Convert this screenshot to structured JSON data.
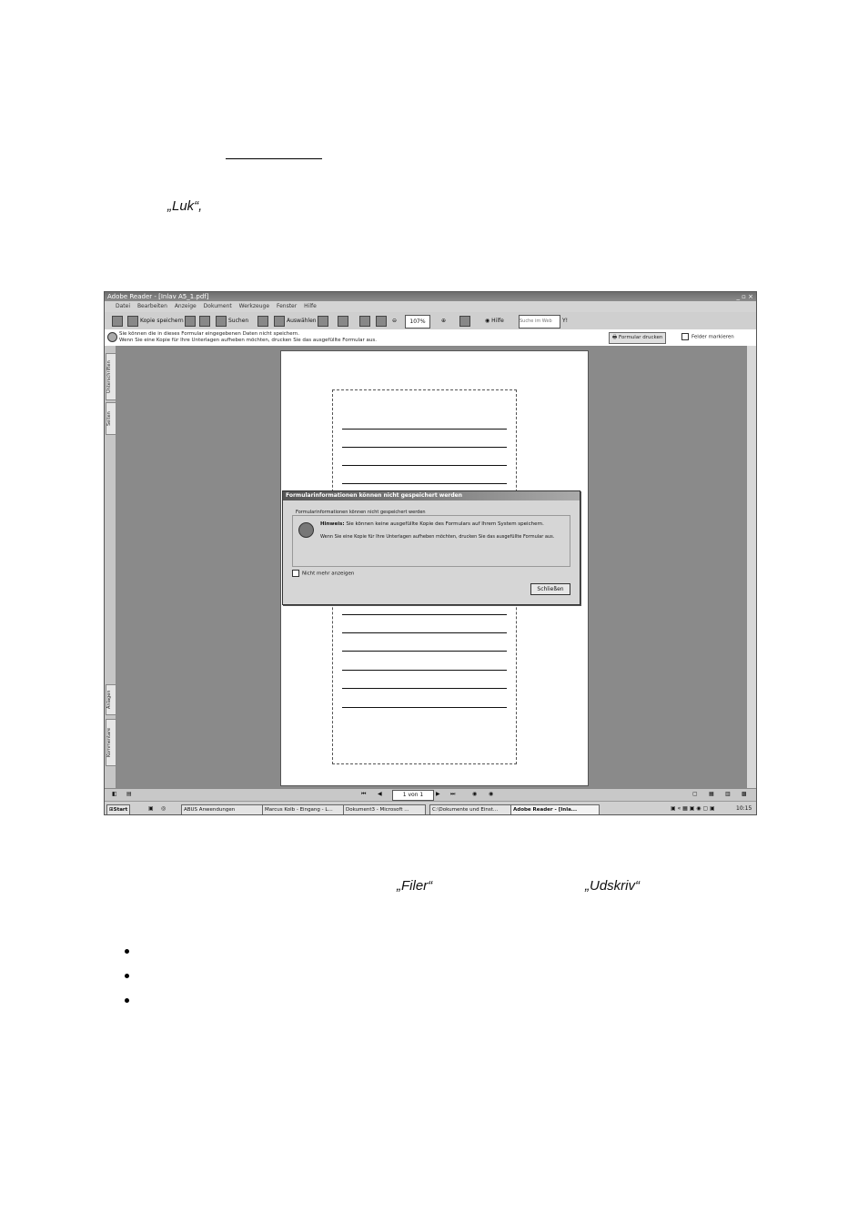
{
  "document": {
    "word_luk": "„Luk“,",
    "word_filer": "„Filer“",
    "word_udskriv": "„Udskriv“",
    "bullets": [
      "",
      "",
      ""
    ]
  },
  "app": {
    "title": "Adobe Reader - [Inlav A5_1.pdf]",
    "menu": [
      "Datei",
      "Bearbeiten",
      "Anzeige",
      "Dokument",
      "Werkzeuge",
      "Fenster",
      "Hilfe"
    ],
    "toolbar": {
      "save_copy": "Kopie speichern",
      "search": "Suchen",
      "select": "Auswählen",
      "zoom": "107%",
      "help": "Hilfe",
      "search_web_placeholder": "Suche im Web"
    },
    "message": {
      "line1": "Sie können die in dieses Formular eingegebenen Daten nicht speichern.",
      "line2": "Wenn Sie eine Kopie für Ihre Unterlagen aufheben möchten, drucken Sie das ausgefüllte Formular aus.",
      "print_form": "Formular drucken",
      "mark_fields": "Felder markieren"
    },
    "left_tabs": [
      "Unterschriften",
      "Seiten",
      "Anlagen",
      "Kommentare"
    ],
    "page_indicator": "1 von 1",
    "dialog": {
      "title": "Formularinformationen können nicht gespeichert werden",
      "group_label": "Formularinformationen können nicht gespeichert werden",
      "hint_label": "Hinweis:",
      "hint_text": "Sie können keine ausgefüllte Kopie des Formulars auf Ihrem System speichern.",
      "info_text": "Wenn Sie eine Kopie für Ihre Unterlagen aufheben möchten, drucken Sie das ausgefüllte Formular aus.",
      "checkbox_label": "Nicht mehr anzeigen",
      "close_button": "Schließen"
    },
    "taskbar": {
      "start": "Start",
      "tasks": [
        "ABUS Anwendungen",
        "Marcus Kolb - Eingang - L...",
        "Dokument3 - Microsoft ...",
        "C:\\Dokumente und Einst...",
        "Adobe Reader - [Inla..."
      ],
      "clock": "10:15"
    }
  }
}
